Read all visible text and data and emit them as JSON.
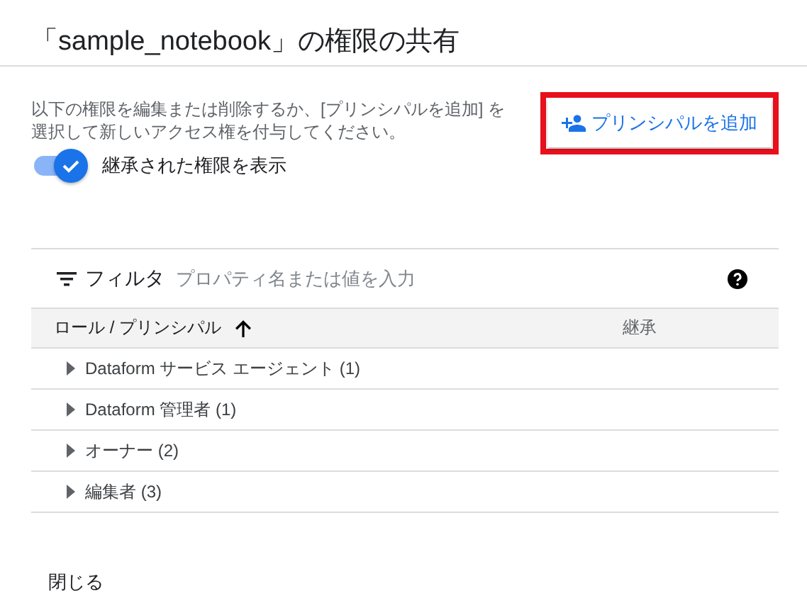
{
  "dialog": {
    "title": "「sample_notebook」の権限の共有"
  },
  "description": "以下の権限を編集または削除するか、[プリンシパルを追加] を選択して新しいアクセス権を付与してください。",
  "add_button": {
    "label": "プリンシパルを追加",
    "highlighted": true
  },
  "inherited_toggle": {
    "label": "継承された権限を表示",
    "on": true
  },
  "filter": {
    "label": "フィルタ",
    "placeholder": "プロパティ名または値を入力"
  },
  "table": {
    "columns": [
      {
        "label": "ロール / プリンシパル",
        "sorted": true
      },
      {
        "label": "継承",
        "sorted": false
      }
    ],
    "rows": [
      {
        "label": "Dataform サービス エージェント (1)",
        "expanded": false
      },
      {
        "label": "Dataform 管理者 (1)",
        "expanded": false
      },
      {
        "label": "オーナー (2)",
        "expanded": false
      },
      {
        "label": "編集者 (3)",
        "expanded": false
      }
    ]
  },
  "close_button": "閉じる"
}
